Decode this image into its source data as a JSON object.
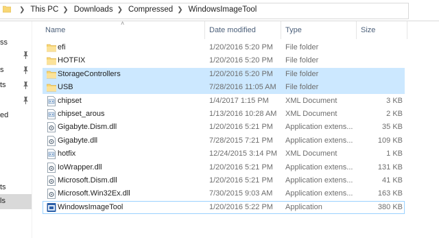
{
  "breadcrumb": [
    "This PC",
    "Downloads",
    "Compressed",
    "WindowsImageTool"
  ],
  "nav": [
    {
      "label": "ss",
      "pinned": false,
      "selected": false
    },
    {
      "label": "",
      "pinned": true,
      "selected": false
    },
    {
      "label": "s",
      "pinned": true,
      "selected": false
    },
    {
      "label": "ts",
      "pinned": true,
      "selected": false
    },
    {
      "label": "",
      "pinned": true,
      "selected": false
    },
    {
      "label": "ed",
      "pinned": false,
      "selected": false
    },
    {
      "label": "ts",
      "pinned": false,
      "selected": false
    },
    {
      "label": "ls",
      "pinned": false,
      "selected": true
    }
  ],
  "columns": {
    "name": "Name",
    "date": "Date modified",
    "type": "Type",
    "size": "Size"
  },
  "files": [
    {
      "name": "efi",
      "date": "1/20/2016 5:20 PM",
      "type": "File folder",
      "size": "",
      "icon": "folder-icon"
    },
    {
      "name": "HOTFIX",
      "date": "1/20/2016 5:20 PM",
      "type": "File folder",
      "size": "",
      "icon": "folder-icon"
    },
    {
      "name": "StorageControllers",
      "date": "1/20/2016 5:20 PM",
      "type": "File folder",
      "size": "",
      "icon": "folder-icon",
      "selected": true
    },
    {
      "name": "USB",
      "date": "7/28/2016 11:05 AM",
      "type": "File folder",
      "size": "",
      "icon": "folder-icon",
      "selected": true
    },
    {
      "name": "chipset",
      "date": "1/4/2017 1:15 PM",
      "type": "XML Document",
      "size": "3 KB",
      "icon": "xml-file-icon"
    },
    {
      "name": "chipset_arous",
      "date": "1/13/2016 10:28 AM",
      "type": "XML Document",
      "size": "2 KB",
      "icon": "xml-file-icon"
    },
    {
      "name": "Gigabyte.Dism.dll",
      "date": "1/20/2016 5:21 PM",
      "type": "Application extens...",
      "size": "35 KB",
      "icon": "dll-file-icon"
    },
    {
      "name": "Gigabyte.dll",
      "date": "7/28/2015 7:21 PM",
      "type": "Application extens...",
      "size": "109 KB",
      "icon": "dll-file-icon"
    },
    {
      "name": "hotfix",
      "date": "12/24/2015 3:14 PM",
      "type": "XML Document",
      "size": "1 KB",
      "icon": "xml-file-icon"
    },
    {
      "name": "IoWrapper.dll",
      "date": "1/20/2016 5:21 PM",
      "type": "Application extens...",
      "size": "131 KB",
      "icon": "dll-file-icon"
    },
    {
      "name": "Microsoft.Dism.dll",
      "date": "1/20/2016 5:21 PM",
      "type": "Application extens...",
      "size": "41 KB",
      "icon": "dll-file-icon"
    },
    {
      "name": "Microsoft.Win32Ex.dll",
      "date": "7/30/2015 9:03 AM",
      "type": "Application extens...",
      "size": "163 KB",
      "icon": "dll-file-icon"
    },
    {
      "name": "WindowsImageTool",
      "date": "1/20/2016 5:22 PM",
      "type": "Application",
      "size": "380 KB",
      "icon": "application-icon",
      "focused": true
    }
  ],
  "colors": {
    "selection": "#cce8ff",
    "focus_border": "#99d1ff",
    "folder": "#f8d775",
    "header_text": "#4c607a"
  }
}
